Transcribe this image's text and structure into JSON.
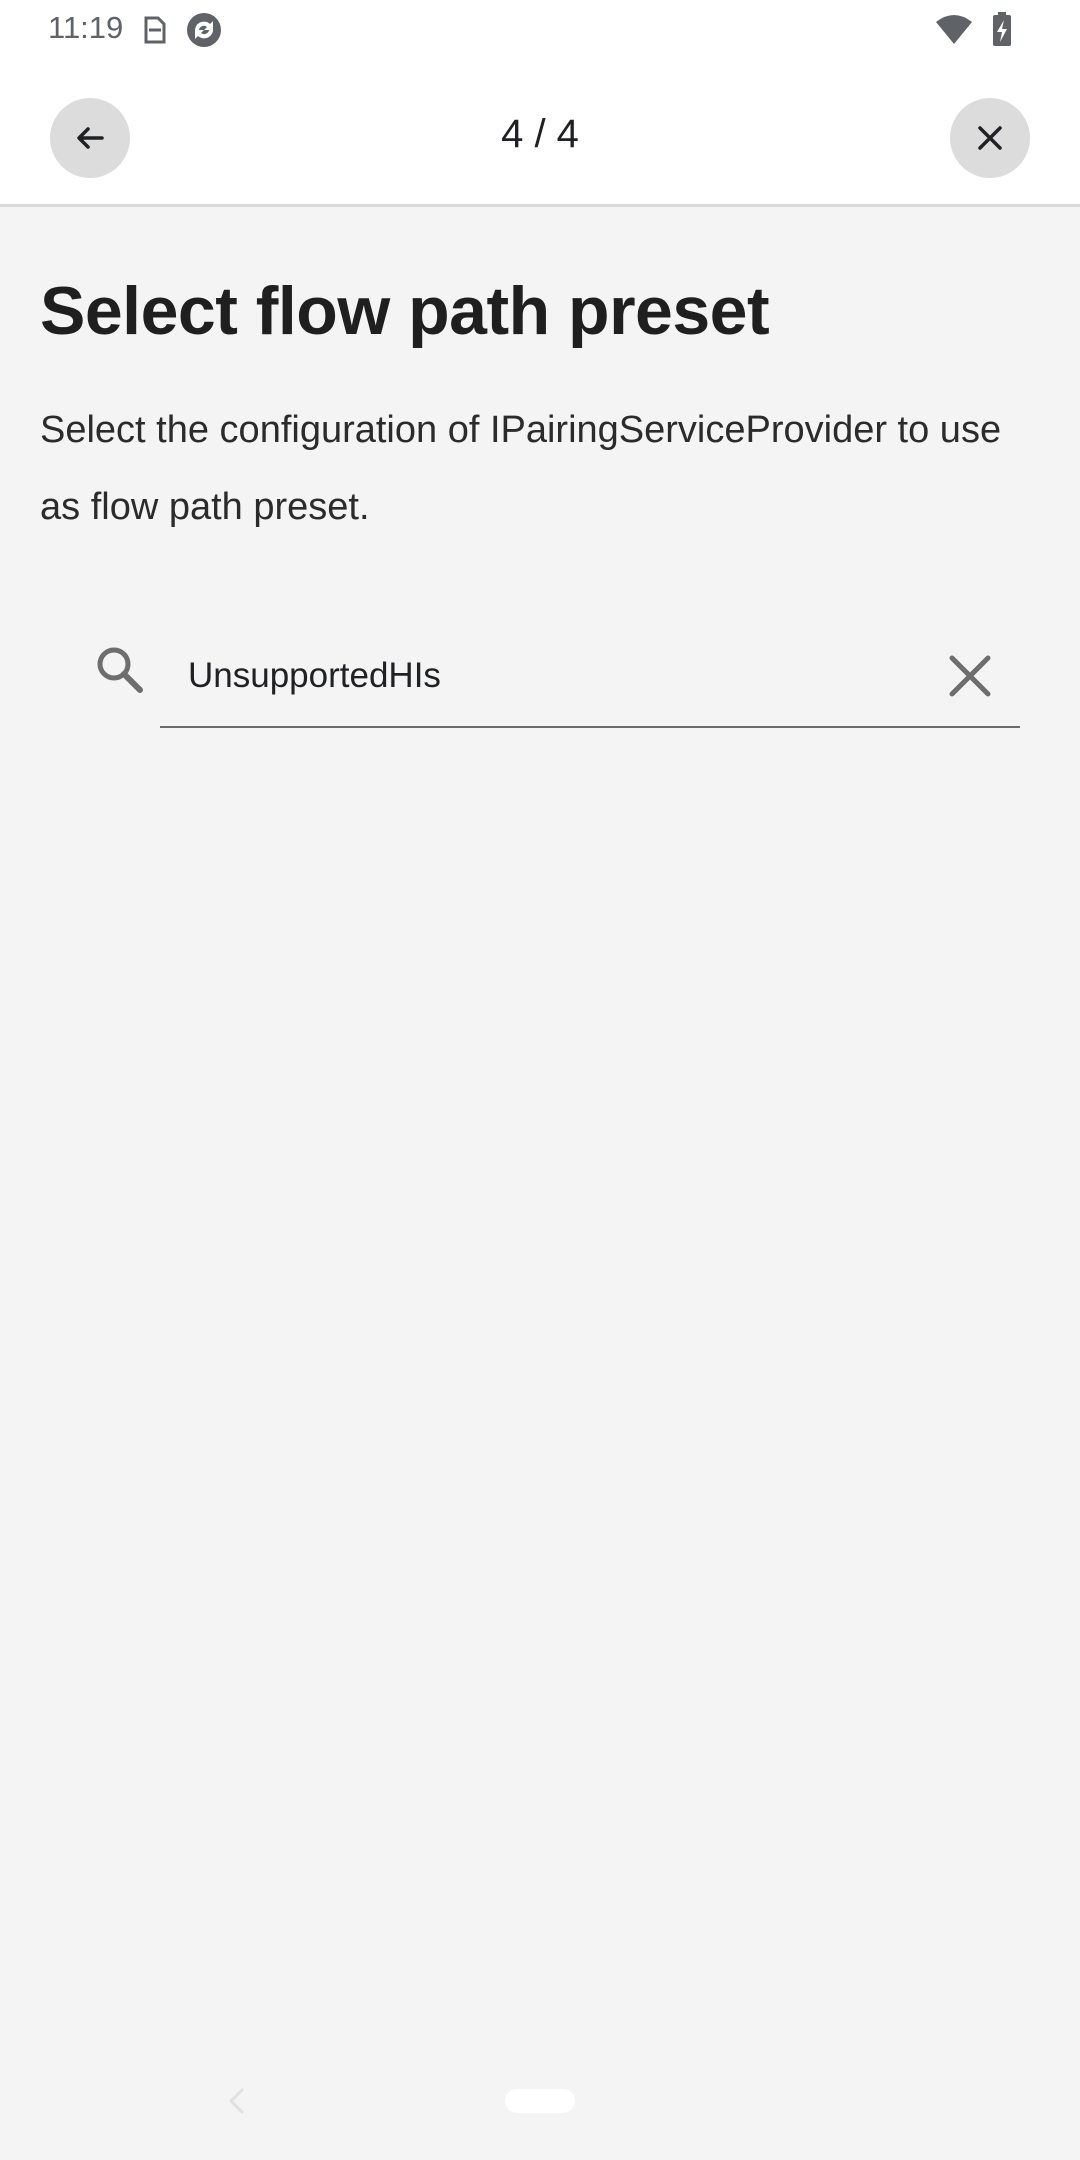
{
  "status_bar": {
    "time": "11:19",
    "icons": [
      "sim-icon",
      "sync-icon",
      "wifi-icon",
      "battery-charging-icon"
    ]
  },
  "header": {
    "step_counter": "4 / 4",
    "back_icon": "arrow-left-icon",
    "close_icon": "close-icon"
  },
  "main": {
    "title": "Select flow path preset",
    "description": "Select the configuration of IPairingServiceProvider to use as flow path preset."
  },
  "search": {
    "value": "UnsupportedHIs",
    "placeholder": "",
    "icon": "search-icon",
    "clear_icon": "clear-icon"
  },
  "nav_bar": {
    "icons": [
      "nav-back-icon",
      "nav-home-pill"
    ]
  },
  "colors": {
    "background": "#f4f4f4",
    "header_bg": "#ffffff",
    "button_circle": "#dcdcdc",
    "text_primary": "#202124",
    "icon_gray": "#5f6368"
  }
}
